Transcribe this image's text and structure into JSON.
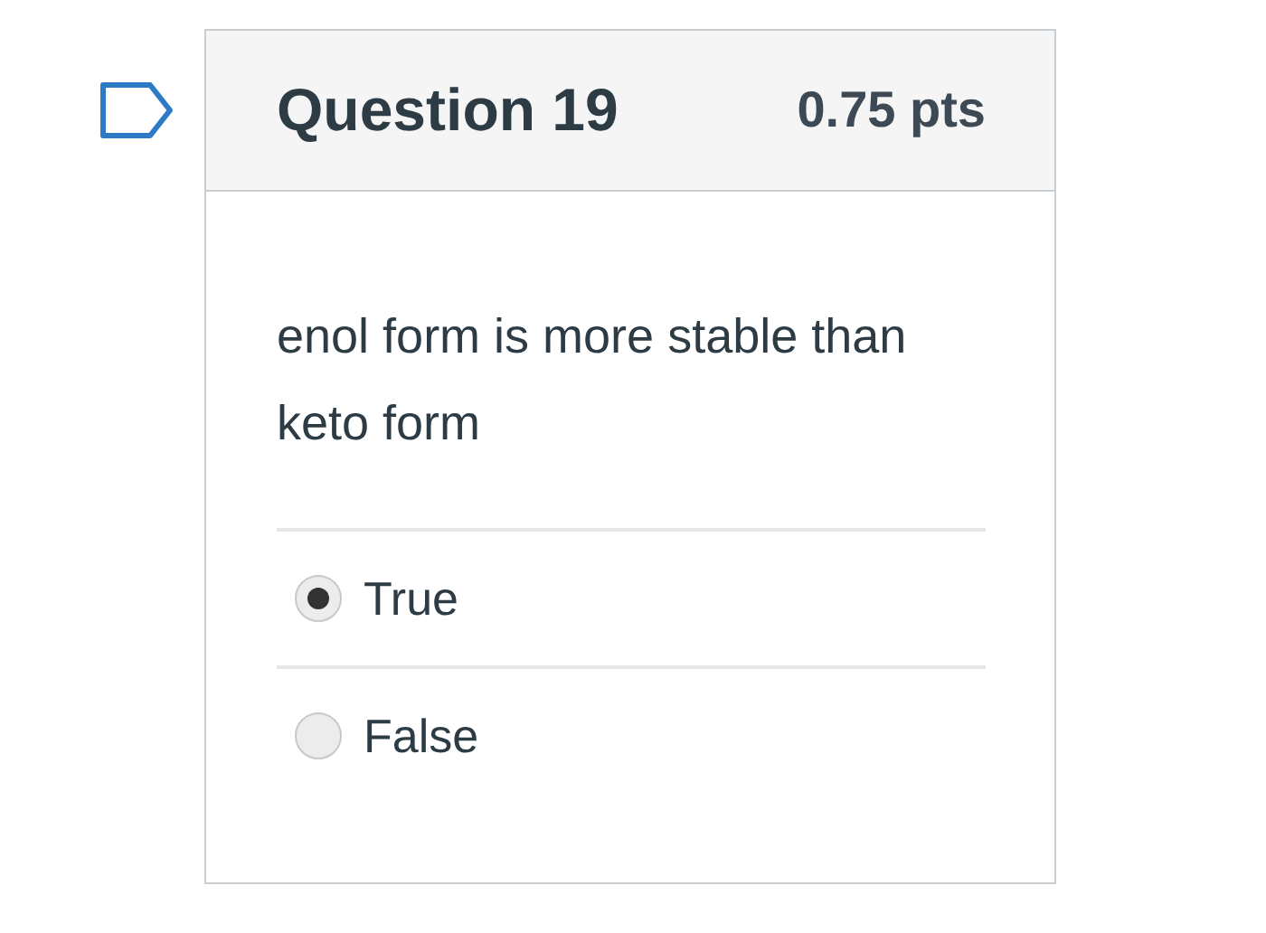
{
  "question": {
    "title": "Question 19",
    "points": "0.75 pts",
    "text": "enol form is more stable than keto form"
  },
  "answers": [
    {
      "label": "True",
      "selected": true
    },
    {
      "label": "False",
      "selected": false
    }
  ]
}
